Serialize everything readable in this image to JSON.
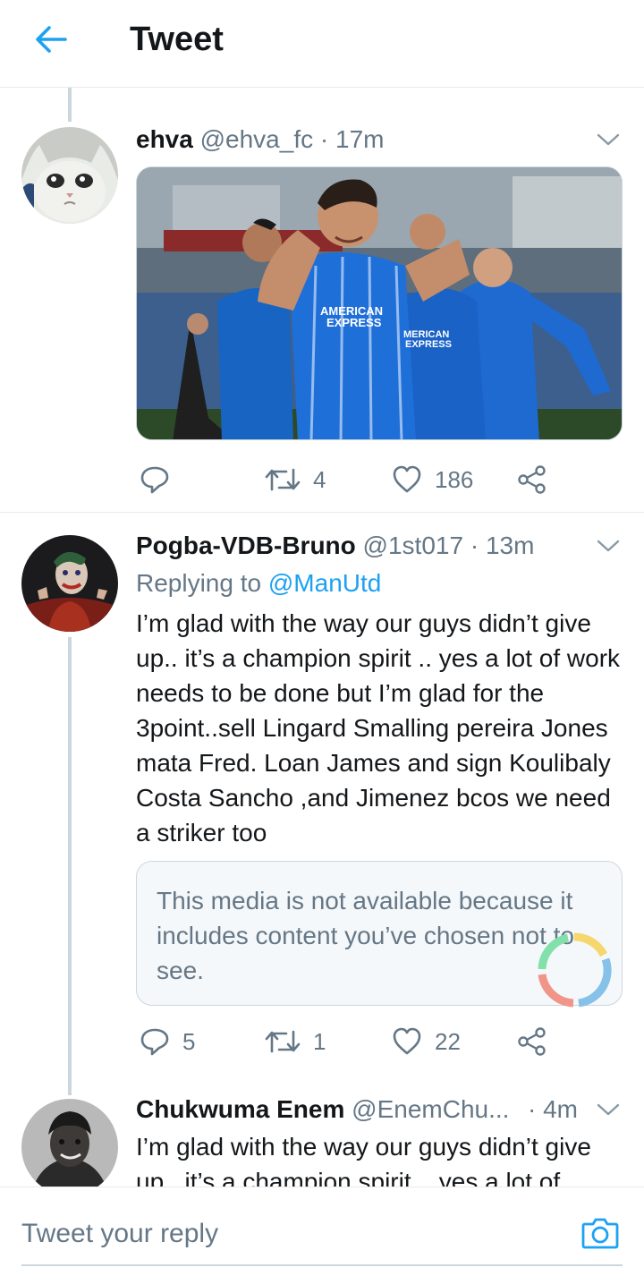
{
  "header": {
    "title": "Tweet",
    "back_icon": "arrow-left-icon",
    "accent": "#1da1f2"
  },
  "tweets": [
    {
      "name": "ehva",
      "handle": "@ehva_fc",
      "dot": "·",
      "time": "17m",
      "media": "photo",
      "actions": {
        "reply": "",
        "retweet": "4",
        "like": "186"
      }
    },
    {
      "name": "Pogba-VDB-Bruno",
      "handle": "@1st017",
      "dot": "·",
      "time": "13m",
      "reply_prefix": "Replying to",
      "reply_target": "@ManUtd",
      "text": "I’m glad with the way our guys didn’t give up.. it’s a champion spirit .. yes a lot of work needs to be done but I’m glad for the 3point..sell Lingard Smalling pereira Jones mata Fred. Loan James and sign Koulibaly Costa Sancho ,and Jimenez bcos we need a striker too",
      "blocked_media": "This media is not available because it includes content you’ve chosen not to see.",
      "actions": {
        "reply": "5",
        "retweet": "1",
        "like": "22"
      }
    },
    {
      "name": "Chukwuma Enem",
      "handle": "@EnemChu...",
      "dot": "·",
      "time": "4m",
      "text": "I’m glad with the way our guys didn’t give up.. it’s a champion spirit .. yes a lot of"
    }
  ],
  "reply_bar": {
    "placeholder": "Tweet your reply",
    "camera_icon": "camera-icon"
  }
}
